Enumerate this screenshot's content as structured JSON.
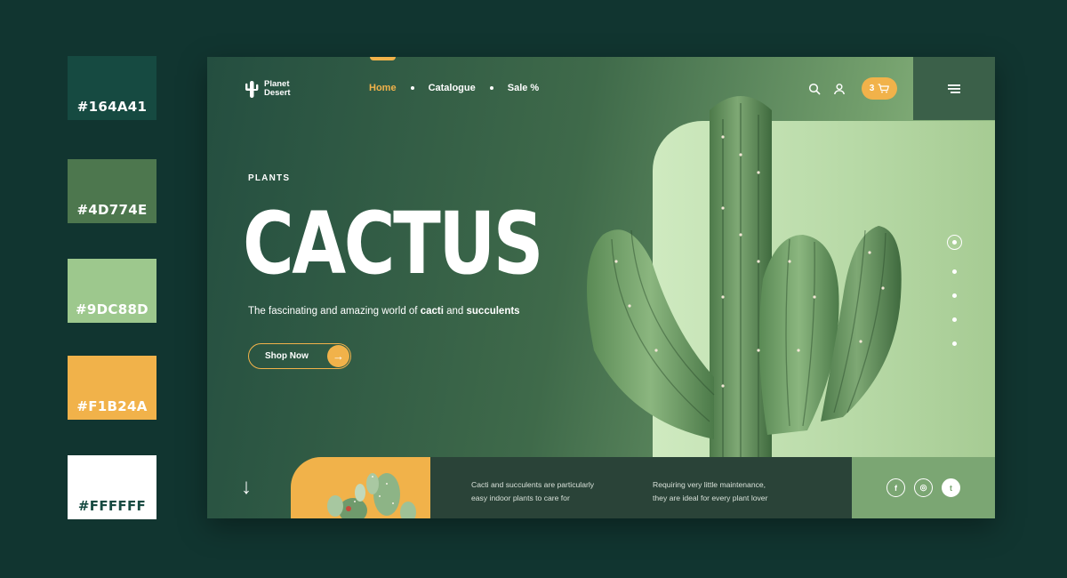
{
  "palette": [
    {
      "hex": "#164A41",
      "label": "#164A41",
      "text_color": "#ffffff"
    },
    {
      "hex": "#4D774E",
      "label": "#4D774E",
      "text_color": "#ffffff"
    },
    {
      "hex": "#9DC88D",
      "label": "#9DC88D",
      "text_color": "#ffffff"
    },
    {
      "hex": "#F1B24A",
      "label": "#F1B24A",
      "text_color": "#ffffff"
    },
    {
      "hex": "#FFFFFF",
      "label": "#FFFFFF",
      "text_color": "#164A41"
    }
  ],
  "brand": {
    "line1": "Planet",
    "line2": "Desert",
    "icon": "cactus-logo-icon"
  },
  "nav": {
    "items": [
      {
        "label": "Home",
        "active": true
      },
      {
        "label": "Catalogue",
        "active": false
      },
      {
        "label": "Sale %",
        "active": false
      }
    ]
  },
  "header": {
    "search_icon": "search-icon",
    "user_icon": "user-icon",
    "cart_count": "3",
    "cart_icon": "cart-icon",
    "menu_icon": "hamburger-icon"
  },
  "hero": {
    "eyebrow": "PLANTS",
    "title": "CACTUS",
    "tagline_prefix": "The fascinating and amazing world of ",
    "tagline_b1": "cacti",
    "tagline_mid": " and ",
    "tagline_b2": "succulents",
    "cta_label": "Shop Now",
    "cta_icon": "arrow-right-icon"
  },
  "pager": {
    "count": 5,
    "active_index": 0
  },
  "bottom": {
    "scroll_icon": "arrow-down-icon",
    "text1_line1": "Cacti and succulents are particularly",
    "text1_line2": "easy indoor plants to care for",
    "text2_line1": "Requiring very little maintenance,",
    "text2_line2": "they are ideal for every plant lover",
    "social": [
      {
        "icon": "facebook-icon",
        "glyph": "f"
      },
      {
        "icon": "instagram-icon",
        "glyph": "◎"
      },
      {
        "icon": "twitter-icon",
        "glyph": "t"
      }
    ]
  },
  "colors": {
    "dark": "#164A41",
    "mid": "#4D774E",
    "light": "#9DC88D",
    "accent": "#F1B24A",
    "white": "#FFFFFF"
  }
}
